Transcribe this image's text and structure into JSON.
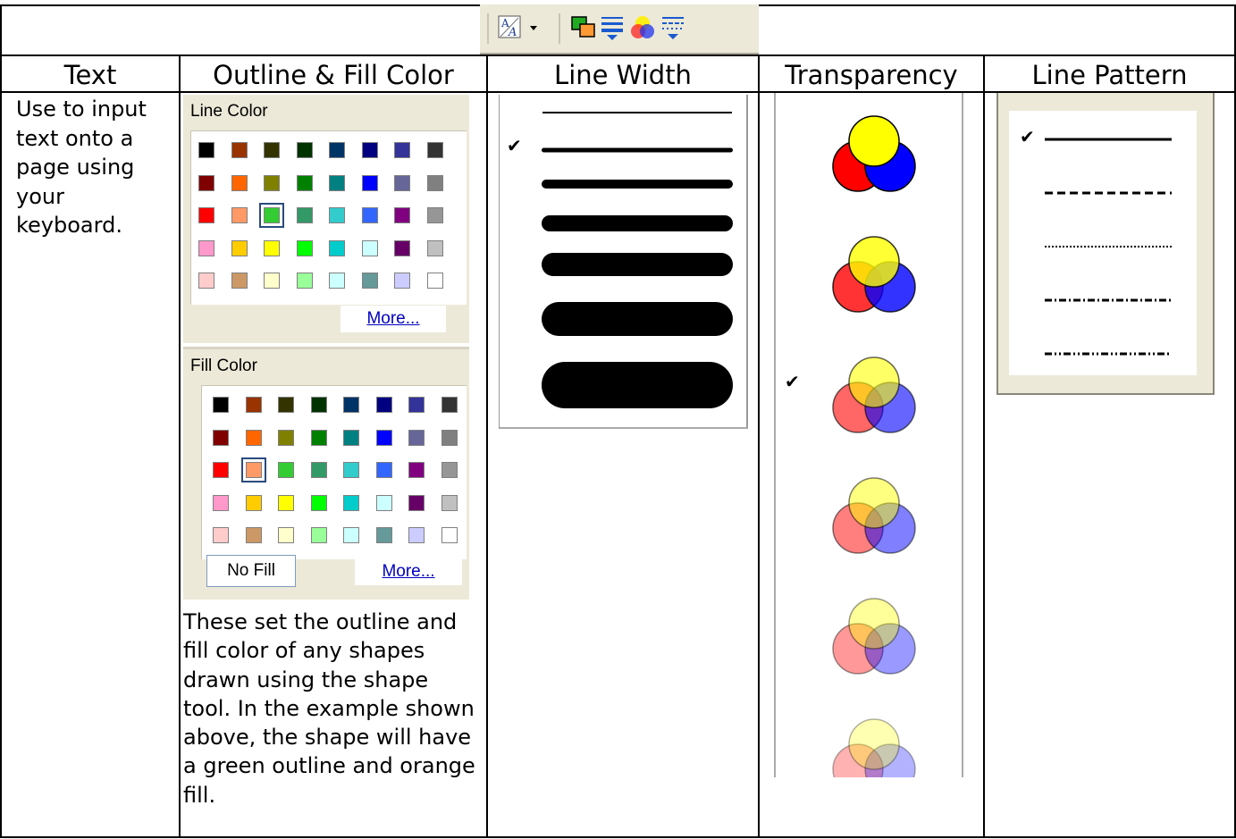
{
  "toolbar": {
    "buttons": [
      {
        "name": "text-style-icon",
        "glyph": "A"
      },
      {
        "name": "dropdown-arrow-icon",
        "glyph": "▾"
      },
      {
        "name": "outline-fill-color-icon",
        "glyph": ""
      },
      {
        "name": "line-width-icon",
        "glyph": ""
      },
      {
        "name": "transparency-icon",
        "glyph": ""
      },
      {
        "name": "line-pattern-icon",
        "glyph": ""
      }
    ]
  },
  "headers": {
    "text": "Text",
    "outline_fill": "Outline & Fill Color",
    "line_width": "Line Width",
    "transparency": "Transparency",
    "line_pattern": "Line Pattern"
  },
  "text_column": {
    "description": "Use to input text onto a page using your keyboard."
  },
  "outline_fill_column": {
    "line_color_title": "Line Color",
    "line_color_more": "More...",
    "fill_color_title": "Fill Color",
    "fill_color_more": "More...",
    "no_fill_label": "No Fill",
    "description": "These set the outline and fill color of any shapes drawn using the shape tool.  In the example shown above, the shape will have a green outline and orange fill.",
    "line_color_selected": "#33cc33",
    "fill_color_selected": "#ff9966",
    "palette_colors": [
      [
        "#000000",
        "#993300",
        "#333300",
        "#003300",
        "#003366",
        "#000080",
        "#333399",
        "#333333"
      ],
      [
        "#800000",
        "#ff6600",
        "#808000",
        "#008000",
        "#008080",
        "#0000ff",
        "#666699",
        "#808080"
      ],
      [
        "#ff0000",
        "#ff9966",
        "#33cc33",
        "#339966",
        "#33cccc",
        "#3366ff",
        "#800080",
        "#969696"
      ],
      [
        "#ff99cc",
        "#ffcc00",
        "#ffff00",
        "#00ff00",
        "#00cccc",
        "#ccffff",
        "#660066",
        "#c0c0c0"
      ],
      [
        "#ffcccc",
        "#cc9966",
        "#ffffcc",
        "#99ff99",
        "#ccffff",
        "#669999",
        "#ccccff",
        "#ffffff"
      ]
    ]
  },
  "line_width_column": {
    "selected_index": 1,
    "check_glyph": "✔"
  },
  "transparency_column": {
    "levels": [
      0,
      20,
      40,
      50,
      60,
      70
    ],
    "selected_index": 2,
    "check_glyph": "✔"
  },
  "line_pattern_column": {
    "patterns": [
      "solid",
      "dashed",
      "dotted",
      "dash-dot",
      "dash-dot-dot"
    ],
    "selected_index": 0,
    "check_glyph": "✔"
  }
}
